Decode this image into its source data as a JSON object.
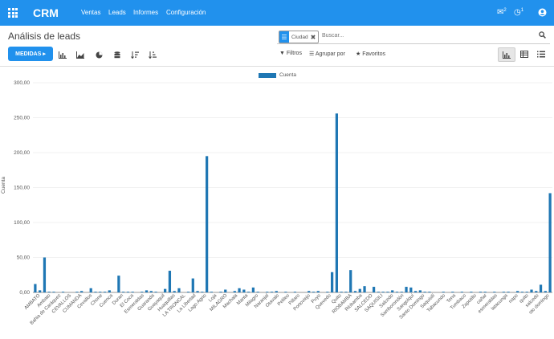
{
  "header": {
    "brand": "CRM",
    "menu": [
      "Ventas",
      "Leads",
      "Informes",
      "Configuración"
    ],
    "messages_count": "2",
    "activities_count": "1"
  },
  "control": {
    "breadcrumb": "Análisis de leads",
    "facet_label": "Ciudad",
    "search_placeholder": "Buscar...",
    "measures_label": "MEDIDAS",
    "filters_label": "Filtros",
    "groupby_label": "Agrupar por",
    "favorites_label": "Favoritos"
  },
  "colors": {
    "brand": "#2191ed",
    "bar": "#1f77b4"
  },
  "chart_data": {
    "type": "bar",
    "legend": "Cuenta",
    "ylabel": "Cuenta",
    "ylim": [
      0,
      300
    ],
    "yticks": [
      "0,00",
      "50,00",
      "100,00",
      "150,00",
      "200,00",
      "250,00",
      "300,00"
    ],
    "labels": [
      "AMBATO",
      "Ambato",
      "Bahia de Caráquez",
      "CEVALLOS",
      "CUMANDA",
      "Cevallos",
      "Chone",
      "Cuenca",
      "Duran",
      "El Coca",
      "Esmeraldas",
      "Guaranda",
      "Guayaquil",
      "Huaquillas",
      "LA TRONCAL",
      "La Libertad",
      "Lago Agrio",
      "Loja",
      "MILAGRO",
      "Machala",
      "Manta",
      "Milagro",
      "Naranjal",
      "Otavalo",
      "Pelileo",
      "Pillaro",
      "Portoviejo",
      "Puyo",
      "Quevedo",
      "Quito",
      "RIOBAMBA",
      "Riobamba",
      "SALCEDO",
      "SAQUISILI",
      "Salcedo",
      "Samborondón",
      "Sangolquí",
      "Santo Domingo",
      "Saquisilí",
      "Tabacundo",
      "Tena",
      "Tumbaco",
      "Zapotillo",
      "cañar",
      "esmeraldas",
      "latacunga",
      "napo",
      "quito",
      "salcedo",
      "sto domingo"
    ],
    "values": [
      12,
      3,
      50,
      1,
      1,
      0,
      1,
      0,
      0,
      1,
      2,
      0,
      6,
      1,
      1,
      1,
      3,
      0,
      24,
      1,
      1,
      1,
      0,
      1,
      3,
      2,
      1,
      0,
      5,
      31,
      2,
      6,
      0,
      1,
      20,
      2,
      1,
      195,
      1,
      0,
      1,
      4,
      0,
      2,
      6,
      4,
      1,
      7,
      1,
      0,
      1,
      1,
      2,
      0,
      1,
      0,
      1,
      0,
      0,
      2,
      1,
      2,
      0,
      1,
      29,
      256,
      1,
      1,
      32,
      2,
      5,
      9,
      0,
      8,
      1,
      1,
      1,
      3,
      1,
      1,
      8,
      7,
      2,
      3,
      1,
      1,
      0,
      0,
      1,
      0,
      1,
      0,
      1,
      0,
      1,
      0,
      1,
      1,
      0,
      1,
      0,
      1,
      1,
      0,
      2,
      1,
      1,
      4,
      2,
      11,
      2,
      142
    ]
  }
}
